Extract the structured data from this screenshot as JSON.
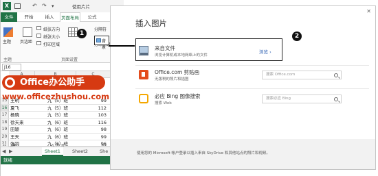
{
  "excel": {
    "filename": "使用片片",
    "tabs": {
      "file": "文件",
      "home": "开始",
      "insert": "插入",
      "page_layout": "页面布局",
      "formula": "公式"
    },
    "ribbon": {
      "theme": "主题",
      "margin": "页边距",
      "paper_orientation": "纸张方向",
      "paper_size": "纸张大小",
      "print_area": "打印区域",
      "separator": "分隔符",
      "background": "背景",
      "print_titles": "打印标题",
      "group_theme": "主题",
      "group_page_setup": "页面设置"
    },
    "namebox": "J16",
    "columns": [
      "A",
      "B",
      "C"
    ],
    "rows": [
      {
        "num": "15",
        "name": "王明",
        "class": "九（5）班",
        "score": "99"
      },
      {
        "num": "16",
        "name": "夏飞",
        "class": "九（5）班",
        "score": "112"
      },
      {
        "num": "17",
        "name": "杨晓",
        "class": "九（5）班",
        "score": "103"
      },
      {
        "num": "18",
        "name": "徐天来",
        "class": "九（6）班",
        "score": "116"
      },
      {
        "num": "19",
        "name": "田颖",
        "class": "九（6）班",
        "score": "98"
      },
      {
        "num": "20",
        "name": "王天",
        "class": "九（6）班",
        "score": "99"
      },
      {
        "num": "21",
        "name": "张羽",
        "class": "九（6）班",
        "score": "96"
      },
      {
        "num": "22",
        "name": "王峰",
        "class": "九（6）班",
        "score": "101"
      }
    ],
    "sheet_tabs": [
      "Sheet1",
      "Sheet2",
      "She"
    ],
    "status": "就绪"
  },
  "watermark": {
    "brand": "Office办公助手",
    "website": "www.officezhushou.com"
  },
  "dialog": {
    "title": "插入图片",
    "close_icon": "close-icon",
    "options": [
      {
        "title": "来自文件",
        "desc": "浏览计算机或本地网络上的文件",
        "action": "浏览 ›",
        "icon": "file-icon"
      },
      {
        "title": "Office.com 剪贴画",
        "desc": "无版税的照片和插图",
        "placeholder": "搜索 Office.com",
        "icon": "office-icon"
      },
      {
        "title": "必应 Bing 图像搜索",
        "desc": "搜索 Web",
        "placeholder": "搜索必应 Bing",
        "icon": "bing-icon"
      }
    ],
    "footer": "使用您的 Microsoft 帐户登录以插入来自 SkyDrive 和其他站点的照片和视频。"
  },
  "callouts": [
    "1",
    "2"
  ],
  "colors": {
    "excel_green": "#217346",
    "brand_red": "#d63a12",
    "office_orange": "#e34c1d",
    "bing_yellow": "#f4a700"
  }
}
